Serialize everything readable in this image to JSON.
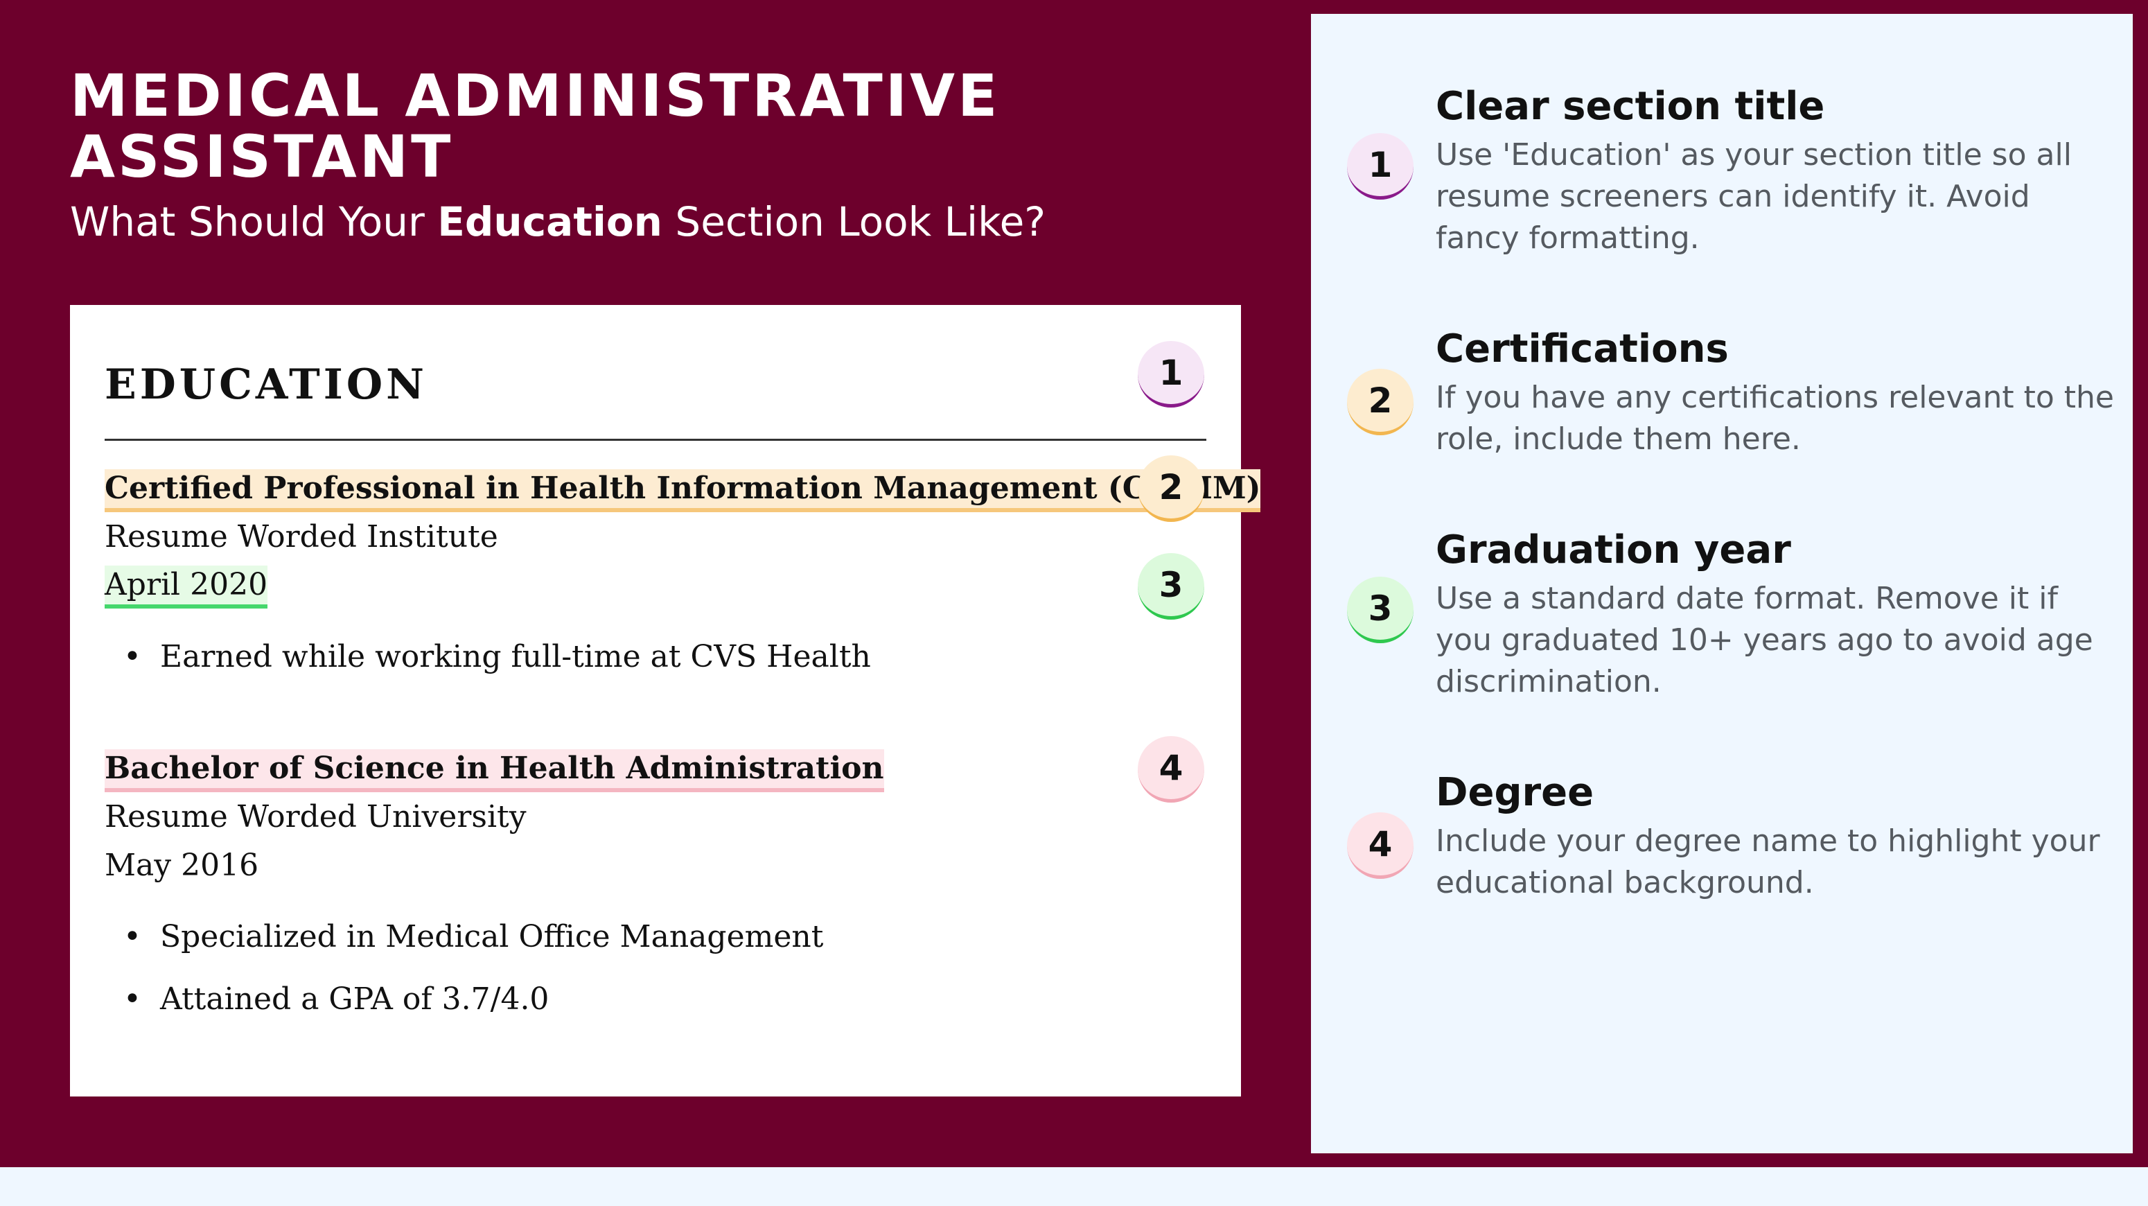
{
  "header": {
    "title_line1": "MEDICAL ADMINISTRATIVE",
    "title_line2": "ASSISTANT",
    "subtitle_prefix": "What Should Your ",
    "subtitle_emphasis": "Education",
    "subtitle_suffix": " Section Look Like?"
  },
  "resume": {
    "section_heading": "EDUCATION",
    "entries": [
      {
        "title": "Certified Professional in Health Information Management (CPHIM)",
        "institution": "Resume Worded Institute",
        "date": "April 2020",
        "bullets": [
          "Earned while working full-time at CVS Health"
        ]
      },
      {
        "title": "Bachelor of Science in Health Administration",
        "institution": "Resume Worded University",
        "date": "May 2016",
        "bullets": [
          "Specialized in Medical Office Management",
          "Attained a GPA of 3.7/4.0"
        ]
      }
    ]
  },
  "badges": [
    "1",
    "2",
    "3",
    "4"
  ],
  "tips": [
    {
      "number": "1",
      "title": "Clear section title",
      "description": "Use 'Education' as your section title so all resume screeners can identify it. Avoid fancy formatting."
    },
    {
      "number": "2",
      "title": "Certifications",
      "description": "If you have any certifications relevant to the role, include them here."
    },
    {
      "number": "3",
      "title": "Graduation year",
      "description": "Use a standard date format. Remove it if you graduated 10+ years ago to avoid age discrimination."
    },
    {
      "number": "4",
      "title": "Degree",
      "description": "Include your degree name to highlight your educational background."
    }
  ],
  "colors": {
    "maroon": "#6d002c",
    "panel_background": "#eff7ff",
    "badge_1_accent": "#8a1a8a",
    "badge_2_accent": "#f2b64f",
    "badge_3_accent": "#2fc84f",
    "badge_4_accent": "#f1a6b4"
  }
}
